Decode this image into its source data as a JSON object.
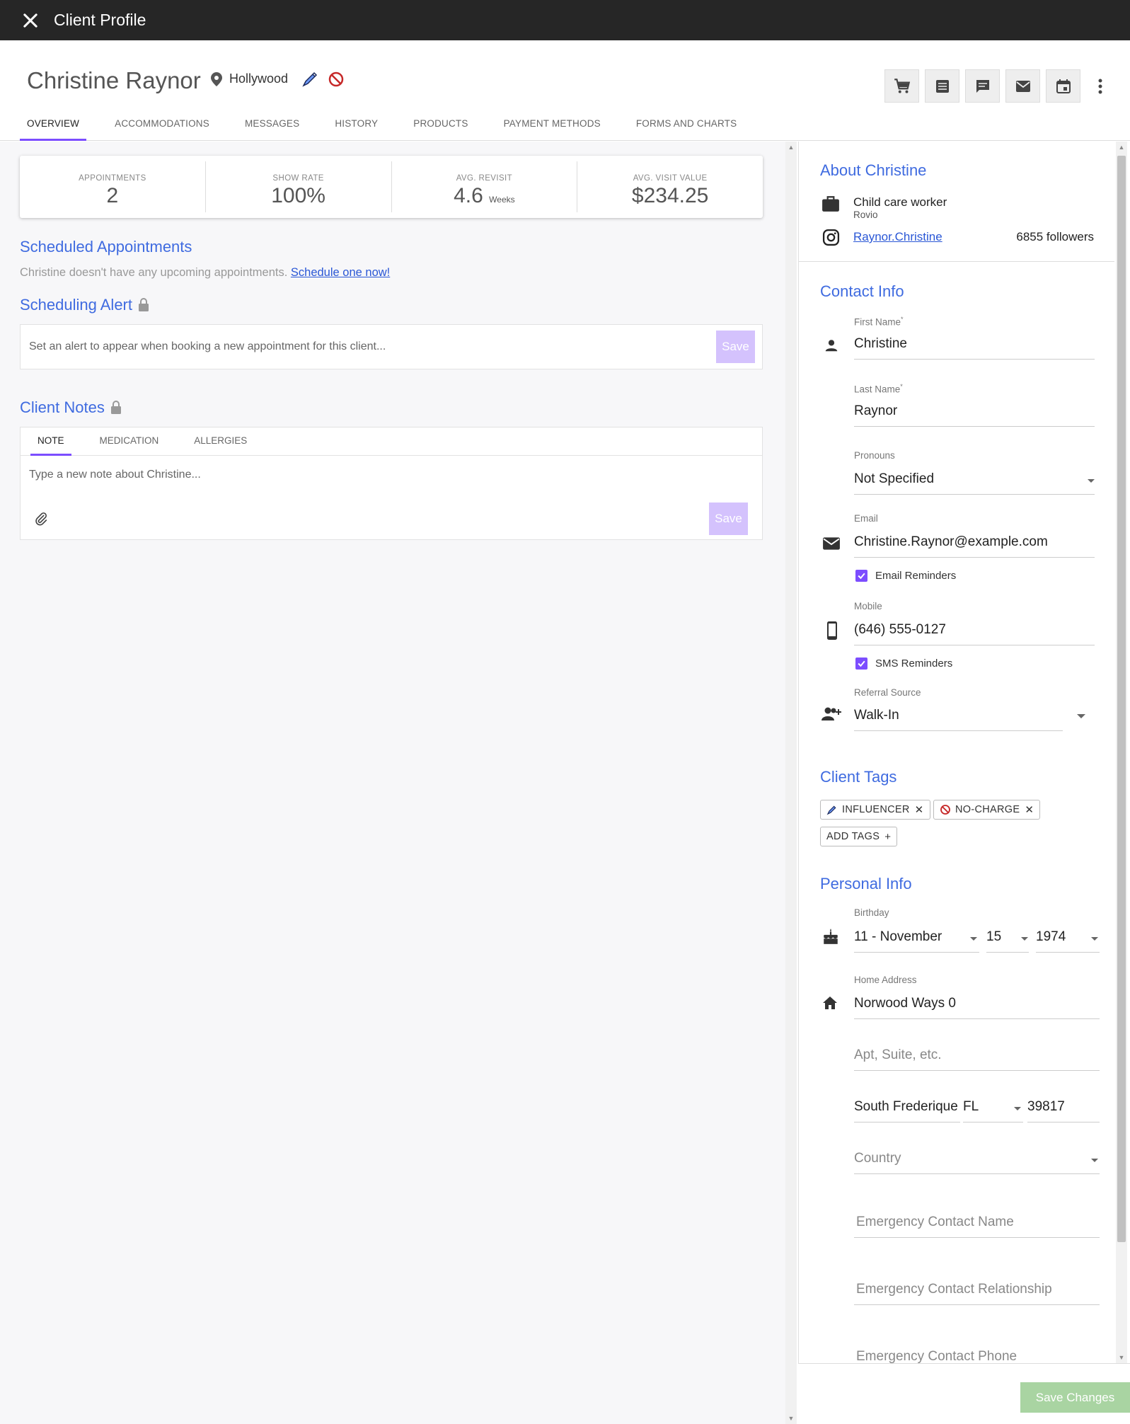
{
  "topbar": {
    "title": "Client Profile"
  },
  "header": {
    "name": "Christine Raynor",
    "location": "Hollywood",
    "tabs": [
      "OVERVIEW",
      "ACCOMMODATIONS",
      "MESSAGES",
      "HISTORY",
      "PRODUCTS",
      "PAYMENT METHODS",
      "FORMS AND CHARTS"
    ],
    "active_tab": "OVERVIEW"
  },
  "stats": [
    {
      "label": "APPOINTMENTS",
      "value": "2",
      "unit": ""
    },
    {
      "label": "SHOW RATE",
      "value": "100%",
      "unit": ""
    },
    {
      "label": "AVG. REVISIT",
      "value": "4.6",
      "unit": "Weeks"
    },
    {
      "label": "AVG. VISIT VALUE",
      "value": "$234.25",
      "unit": ""
    }
  ],
  "scheduled": {
    "title": "Scheduled Appointments",
    "empty_text": "Christine doesn't have any upcoming appointments.",
    "link": "Schedule one now!"
  },
  "alert": {
    "title": "Scheduling Alert",
    "placeholder": "Set an alert to appear when booking a new appointment for this client...",
    "save": "Save"
  },
  "notes": {
    "title": "Client Notes",
    "tabs": [
      "NOTE",
      "MEDICATION",
      "ALLERGIES"
    ],
    "placeholder": "Type a new note about Christine...",
    "save": "Save"
  },
  "about": {
    "title": "About Christine",
    "job": "Child care worker",
    "company": "Rovio",
    "instagram": "Raynor.Christine",
    "followers": "6855 followers"
  },
  "contact": {
    "title": "Contact Info",
    "first_name_label": "First Name",
    "first_name": "Christine",
    "last_name_label": "Last Name",
    "last_name": "Raynor",
    "pronouns_label": "Pronouns",
    "pronouns": "Not Specified",
    "email_label": "Email",
    "email": "Christine.Raynor@example.com",
    "email_reminders": "Email Reminders",
    "mobile_label": "Mobile",
    "mobile": "(646) 555-0127",
    "sms_reminders": "SMS Reminders",
    "referral_label": "Referral Source",
    "referral": "Walk-In"
  },
  "tags": {
    "title": "Client Tags",
    "items": [
      "INFLUENCER",
      "NO-CHARGE"
    ],
    "add": "ADD TAGS"
  },
  "personal": {
    "title": "Personal Info",
    "birthday_label": "Birthday",
    "birth_month": "11 - November",
    "birth_day": "15",
    "birth_year": "1974",
    "address_label": "Home Address",
    "address1": "Norwood Ways 0",
    "address2_placeholder": "Apt, Suite, etc.",
    "city": "South Frederique",
    "state": "FL",
    "zip": "39817",
    "country_placeholder": "Country",
    "ec_name_placeholder": "Emergency Contact Name",
    "ec_rel_placeholder": "Emergency Contact Relationship",
    "ec_phone_placeholder": "Emergency Contact Phone"
  },
  "footer": {
    "save_changes": "Save Changes"
  },
  "colors": {
    "accent": "#7c4dff",
    "link": "#3f6be0",
    "topbar": "#262626",
    "save_disabled": "#a9d4a2"
  }
}
